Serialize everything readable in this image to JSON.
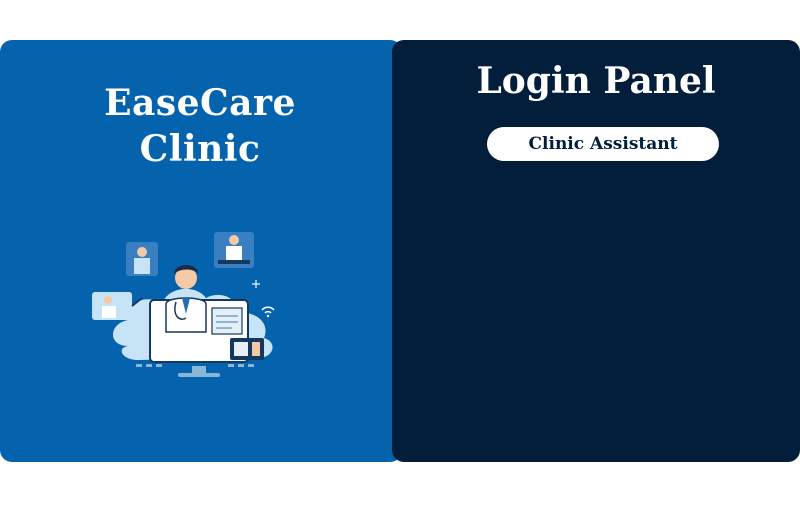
{
  "brand": {
    "line1": "EaseCare",
    "line2": "Clinic"
  },
  "login": {
    "title": "Login Panel",
    "role_label": "Clinic Assistant"
  },
  "colors": {
    "left_panel": "#0562ad",
    "right_panel": "#031e3b",
    "badge_bg": "#ffffff",
    "text": "#ffffff"
  },
  "illustration": {
    "icon": "doctor-telemedicine-illustration"
  }
}
